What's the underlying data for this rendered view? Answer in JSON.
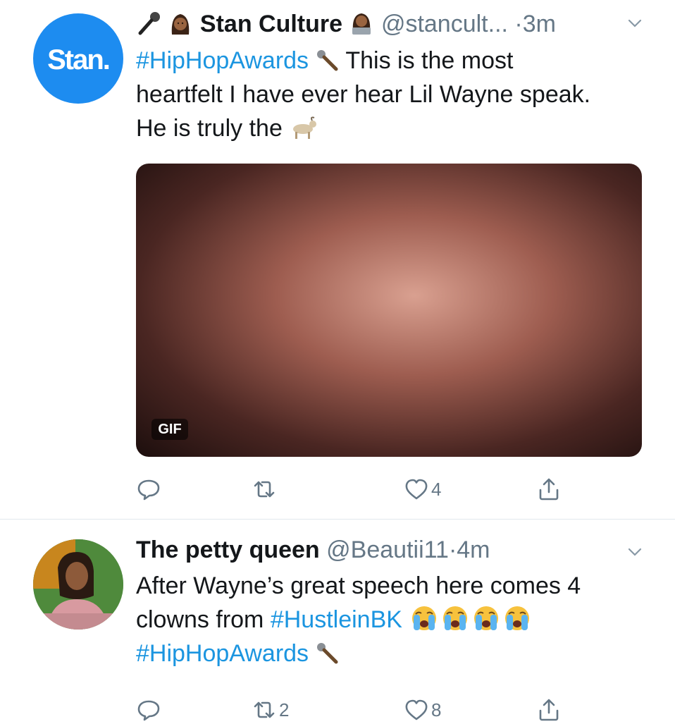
{
  "tweets": [
    {
      "name": "Stan Culture",
      "handle": "@stancult...",
      "dot": "·",
      "time": "3m",
      "avatar_text": "Stan.",
      "text": {
        "hashtag1": "#HipHopAwards",
        "line1_rest": "This is the most",
        "line2": "heartfelt I have ever hear Lil Wayne speak.",
        "line3": "He is truly the"
      },
      "media_badge": "GIF",
      "actions": {
        "reply": "",
        "retweet": "",
        "like": "4"
      },
      "icons": [
        "microphone-icon",
        "woman-emoji-icon",
        "woman-technologist-emoji-icon",
        "chevron-down-icon",
        "microphone-emoji-icon",
        "goat-emoji-icon",
        "reply-icon",
        "retweet-icon",
        "like-icon",
        "share-icon"
      ]
    },
    {
      "name": "The petty queen",
      "handle": "@Beautii11",
      "dot": "·",
      "time": "4m",
      "text": {
        "line1": "After Wayne’s great speech here comes 4",
        "line2_start": "clowns from ",
        "hashtag1": "#HustleinBK",
        "hashtag2": "#HipHopAwards"
      },
      "actions": {
        "reply": "",
        "retweet": "2",
        "like": "8"
      },
      "icons": [
        "chevron-down-icon",
        "crying-face-emoji-icon",
        "microphone-emoji-icon",
        "reply-icon",
        "retweet-icon",
        "like-icon",
        "share-icon"
      ]
    }
  ],
  "colors": {
    "accent": "#1b95e0",
    "secondary": "#657786",
    "divider": "#e1e8ed",
    "avatar_bg": "#1d8cf0"
  }
}
